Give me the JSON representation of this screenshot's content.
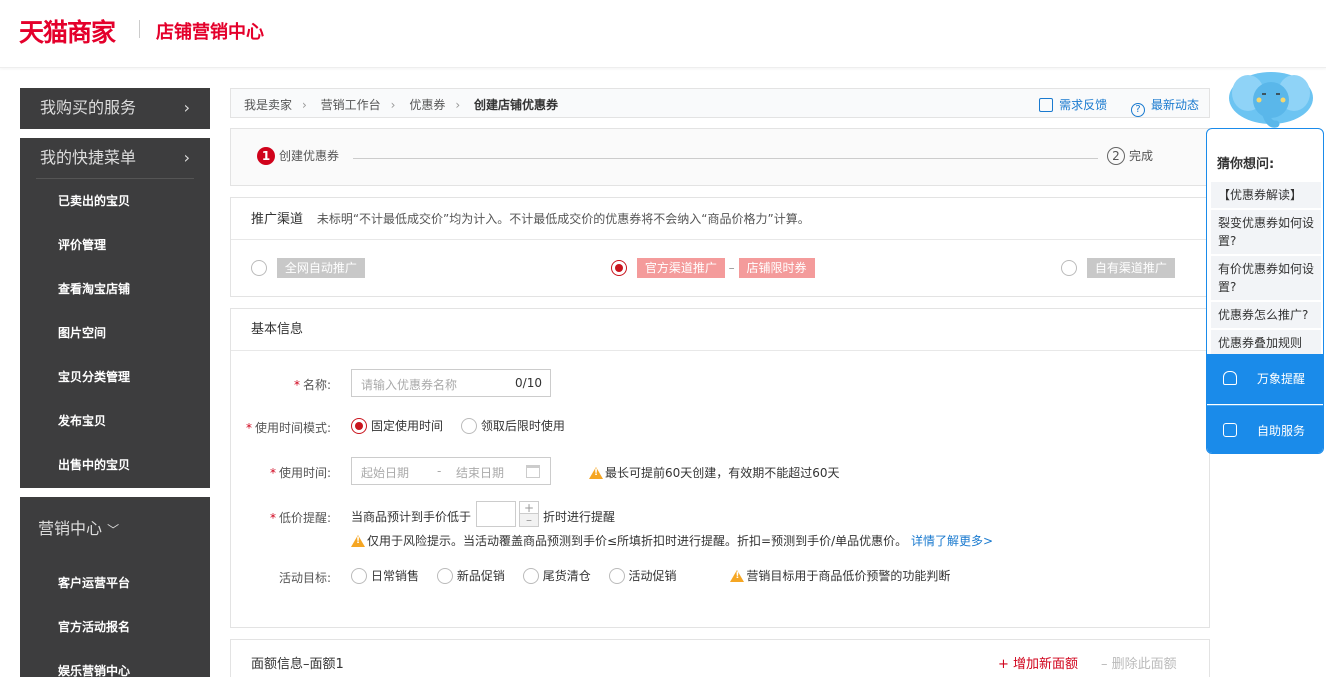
{
  "header": {
    "logo": "天猫商家",
    "subtitle": "店铺营销中心"
  },
  "sidebar": {
    "services": "我购买的服务",
    "quick_menu": {
      "title": "我的快捷菜单",
      "items": [
        "已卖出的宝贝",
        "评价管理",
        "查看淘宝店铺",
        "图片空间",
        "宝贝分类管理",
        "发布宝贝",
        "出售中的宝贝"
      ]
    },
    "marketing": {
      "title": "营销中心",
      "items": [
        "客户运营平台",
        "官方活动报名",
        "娱乐营销中心"
      ]
    }
  },
  "breadcrumb": {
    "items": [
      "我是卖家",
      "营销工作台",
      "优惠券",
      "创建店铺优惠券"
    ],
    "feedback": "需求反馈",
    "news": "最新动态"
  },
  "steps": {
    "step1_num": "1",
    "step1": "创建优惠券",
    "step2_num": "2",
    "step2": "完成"
  },
  "channel": {
    "title": "推广渠道",
    "note": "未标明“不计最低成交价”均为计入。不计最低成交价的优惠券将不会纳入“商品价格力”计算。",
    "opt1": "全网自动推广",
    "opt2a": "官方渠道推广",
    "opt2_sep": "–",
    "opt2b": "店铺限时券",
    "opt3": "自有渠道推广"
  },
  "basic": {
    "title": "基本信息",
    "name_label": "名称:",
    "name_placeholder": "请输入优惠券名称",
    "name_count": "0/10",
    "time_mode_label": "使用时间模式:",
    "time_mode_fixed": "固定使用时间",
    "time_mode_after": "领取后限时使用",
    "use_time_label": "使用时间:",
    "start_date": "起始日期",
    "date_sep": "-",
    "end_date": "结束日期",
    "use_time_warn": "最长可提前60天创建，有效期不能超过60天",
    "low_price_label": "低价提醒:",
    "low_price_prefix": "当商品预计到手价低于",
    "low_price_suffix": "折时进行提醒",
    "low_price_note": "仅用于风险提示。当活动覆盖商品预测到手价≤所填折扣时进行提醒。折扣=预测到手价/单品优惠价。",
    "low_price_link": "详情了解更多>",
    "goal_label": "活动目标:",
    "goals": [
      "日常销售",
      "新品促销",
      "尾货清仓",
      "活动促销"
    ],
    "goal_warn": "营销目标用于商品低价预警的功能判断"
  },
  "face": {
    "title": "面额信息–面额1",
    "add": "+ 增加新面额",
    "del": "– 删除此面额"
  },
  "helper": {
    "title": "猜你想问:",
    "questions": [
      "【优惠券解读】",
      "裂变优惠券如何设置?",
      "有价优惠券如何设置?",
      "优惠券怎么推广?",
      "优惠券叠加规则"
    ],
    "btn1": "万象提醒",
    "btn2": "自助服务"
  }
}
